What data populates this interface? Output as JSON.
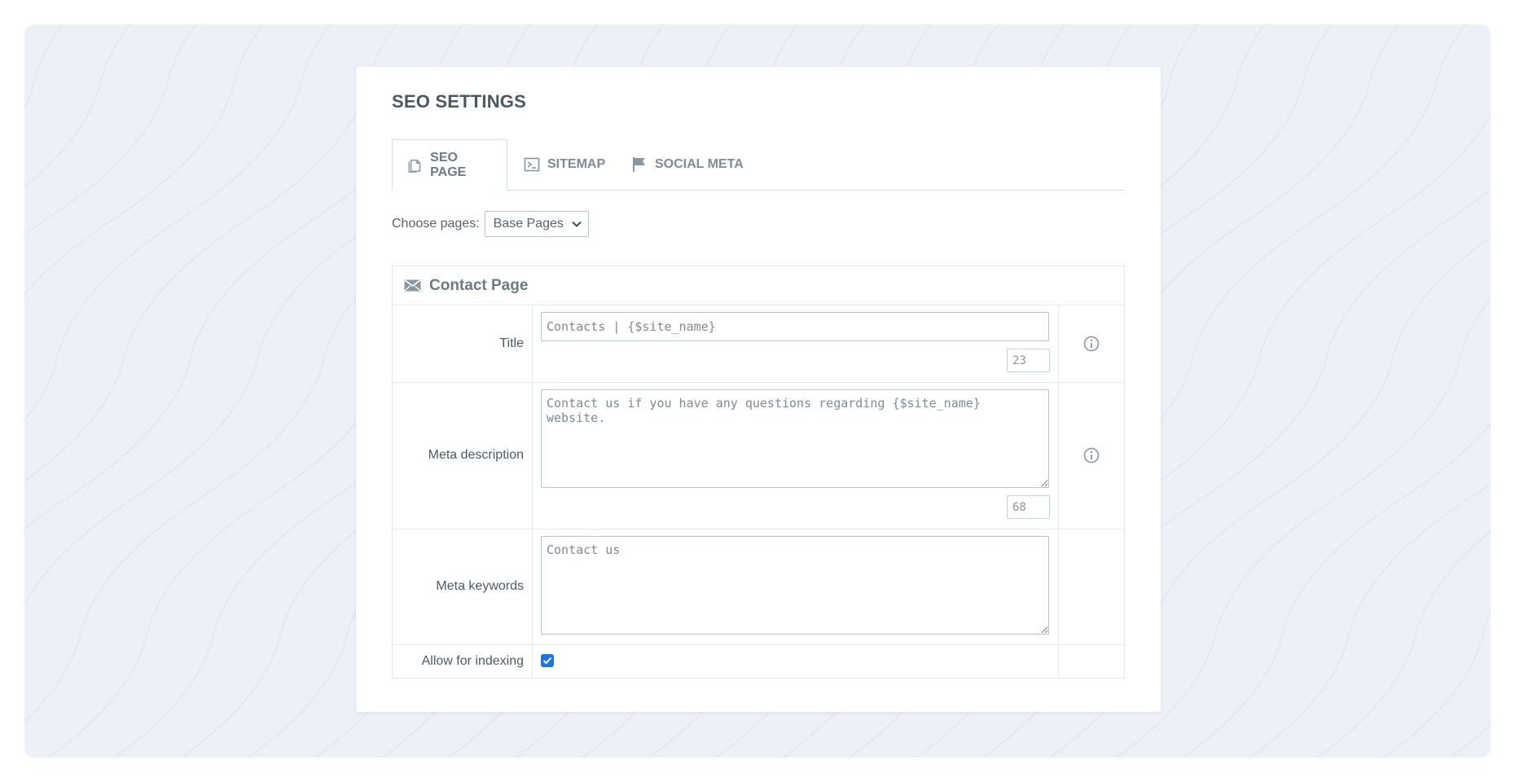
{
  "page": {
    "title": "SEO SETTINGS"
  },
  "tabs": [
    {
      "label": "SEO PAGE",
      "icon": "copy-pages-icon",
      "active": true
    },
    {
      "label": "SITEMAP",
      "icon": "sitemap-icon",
      "active": false
    },
    {
      "label": "SOCIAL META",
      "icon": "flag-icon",
      "active": false
    }
  ],
  "chooser": {
    "label": "Choose pages:",
    "selected": "Base Pages"
  },
  "panel": {
    "icon": "envelope-icon",
    "title": "Contact Page"
  },
  "fields": {
    "title": {
      "label": "Title",
      "value": "Contacts | {$site_name}",
      "count": "23"
    },
    "description": {
      "label": "Meta description",
      "value": "Contact us if you have any questions regarding {$site_name} website.",
      "count": "68"
    },
    "keywords": {
      "label": "Meta keywords",
      "value": "Contact us"
    },
    "indexing": {
      "label": "Allow for indexing",
      "checked": true
    }
  },
  "colors": {
    "background": "#eef0f8",
    "accent": "#1a73e8",
    "text": "#4a5a66"
  }
}
